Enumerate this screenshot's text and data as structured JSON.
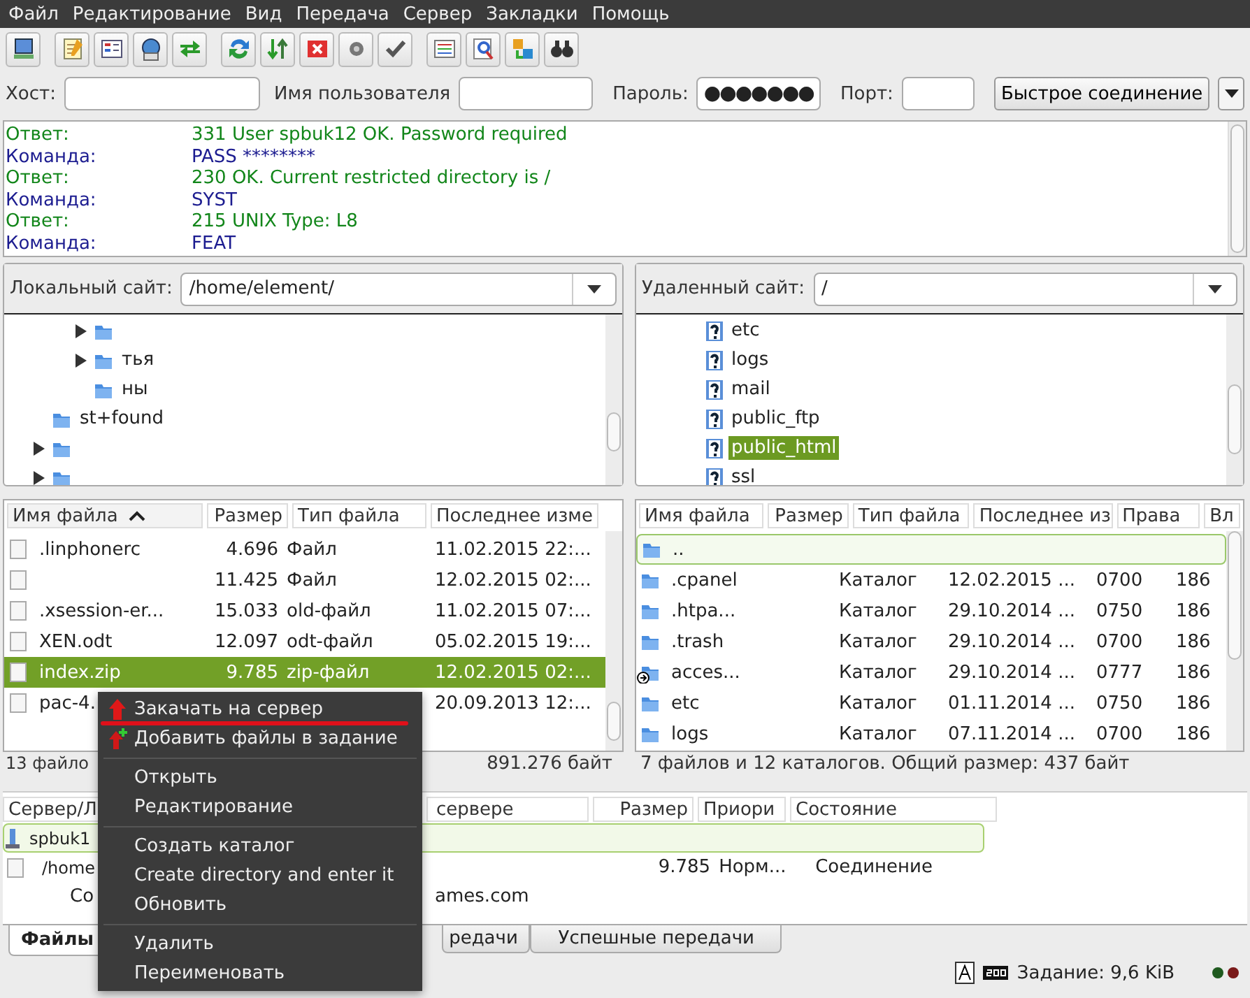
{
  "menu_bar": [
    "Файл",
    "Редактирование",
    "Вид",
    "Передача",
    "Сервер",
    "Закладки",
    "Помощь"
  ],
  "quickconnect": {
    "host_label": "Хост:",
    "user_label": "Имя пользователя",
    "password_label": "Пароль:",
    "password_value": "●●●●●●●",
    "port_label": "Порт:",
    "connect_button": "Быстрое соединение"
  },
  "log": [
    {
      "kind": "response",
      "label": "Ответ:",
      "text": "331 User spbuk12 OK. Password required"
    },
    {
      "kind": "command",
      "label": "Команда:",
      "text": "PASS ********"
    },
    {
      "kind": "response",
      "label": "Ответ:",
      "text": "230 OK. Current restricted directory is /"
    },
    {
      "kind": "command",
      "label": "Команда:",
      "text": "SYST"
    },
    {
      "kind": "response",
      "label": "Ответ:",
      "text": "215 UNIX Type: L8"
    },
    {
      "kind": "command",
      "label": "Команда:",
      "text": "FEAT"
    }
  ],
  "local_site": {
    "label": "Локальный сайт:",
    "path": "/home/element/",
    "tree": [
      {
        "children": [
          {
            "expandable": true
          },
          {
            "expandable": true,
            "label": "тья"
          },
          {
            "expandable": false,
            "label": "ны"
          }
        ]
      },
      {
        "expandable": false,
        "label": "st+found"
      },
      {
        "expandable": true
      },
      {
        "expandable": true
      }
    ]
  },
  "remote_site": {
    "label": "Удаленный сайт:",
    "path": "/",
    "tree": [
      {
        "label": "etc",
        "selected": false
      },
      {
        "label": "logs",
        "selected": false
      },
      {
        "label": "mail",
        "selected": false
      },
      {
        "label": "public_ftp",
        "selected": false
      },
      {
        "label": "public_html",
        "selected": true
      },
      {
        "label": "ssl",
        "selected": false
      }
    ]
  },
  "local_files": {
    "columns": [
      {
        "label": "Имя файла",
        "sorted": true
      },
      {
        "label": "Размер",
        "sorted": false
      },
      {
        "label": "Тип файла",
        "sorted": false
      },
      {
        "label": "Последнее изме",
        "sorted": false
      }
    ],
    "rows": [
      {
        "name": ".linphonerc",
        "size": "4.696",
        "type": "Файл",
        "modified": "11.02.2015 22:...",
        "selected": false
      },
      {
        "size": "11.425",
        "type": "Файл",
        "modified": "12.02.2015 02:...",
        "selected": false
      },
      {
        "name": ".xsession-er...",
        "size": "15.033",
        "type": "old-файл",
        "modified": "11.02.2015 07:...",
        "selected": false
      },
      {
        "name": "XEN.odt",
        "size": "12.097",
        "type": "odt-файл",
        "modified": "05.02.2015 19:...",
        "selected": false
      },
      {
        "name": "index.zip",
        "size": "9.785",
        "type": "zip-файл",
        "modified": "12.02.2015 02:...",
        "selected": true
      },
      {
        "name": "pac-4.",
        "modified": "20.09.2013 12:...",
        "selected": false
      }
    ],
    "status": [
      "13 файло",
      "891.276 байт"
    ]
  },
  "remote_files": {
    "columns": [
      "Имя файла",
      "Размер",
      "Тип файла",
      "Последнее из",
      "Права",
      "Вл"
    ],
    "rows": [
      {
        "name": "..",
        "focused": true,
        "link": false
      },
      {
        "name": ".cpanel",
        "type": "Каталог",
        "modified": "12.02.2015 ...",
        "rights": "0700",
        "owner": "186",
        "focused": false,
        "link": false
      },
      {
        "name": ".htpa...",
        "type": "Каталог",
        "modified": "29.10.2014 ...",
        "rights": "0750",
        "owner": "186",
        "focused": false,
        "link": false
      },
      {
        "name": ".trash",
        "type": "Каталог",
        "modified": "29.10.2014 ...",
        "rights": "0700",
        "owner": "186",
        "focused": false,
        "link": false
      },
      {
        "name": "acces...",
        "type": "Каталог",
        "modified": "29.10.2014 ...",
        "rights": "0777",
        "owner": "186",
        "focused": false,
        "link": true
      },
      {
        "name": "etc",
        "type": "Каталог",
        "modified": "01.11.2014 ...",
        "rights": "0750",
        "owner": "186",
        "focused": false,
        "link": false
      },
      {
        "name": "logs",
        "type": "Каталог",
        "modified": "07.11.2014 ...",
        "rights": "0700",
        "owner": "186",
        "focused": false,
        "link": false
      }
    ],
    "status": "7 файлов и 12 каталогов. Общий размер: 437 байт"
  },
  "queue": {
    "columns": [
      "Сервер/Л",
      "сервере",
      "Размер",
      "Приори",
      "Состояние"
    ],
    "rows": [
      {
        "kind": "server",
        "name": "spbuk1"
      },
      {
        "kind": "file",
        "name": "/home",
        "size": "9.785",
        "priority": "Норм...",
        "state": "Соединение"
      },
      {
        "kind": "detail",
        "name": "Co",
        "rest": "ames.com"
      }
    ]
  },
  "tabs": [
    {
      "label": "Файлы",
      "selected": true
    },
    {
      "label": "редачи",
      "selected": false
    },
    {
      "label": "Успешные передачи",
      "selected": false
    }
  ],
  "status_bar": {
    "queue": "Задание: 9,6 KiB"
  },
  "context_menu": [
    [
      {
        "label": "Закачать на сервер",
        "underlined": true
      },
      {
        "label": "Добавить файлы в задание",
        "underlined": false
      }
    ],
    [
      {
        "label": "Открыть",
        "underlined": false
      },
      {
        "label": "Редактирование",
        "underlined": false
      }
    ],
    [
      {
        "label": "Создать каталог",
        "underlined": false
      },
      {
        "label": "Create directory and enter it",
        "underlined": false
      },
      {
        "label": "Обновить",
        "underlined": false
      }
    ],
    [
      {
        "label": "Удалить",
        "underlined": false
      },
      {
        "label": "Переименовать",
        "underlined": false
      }
    ]
  ]
}
